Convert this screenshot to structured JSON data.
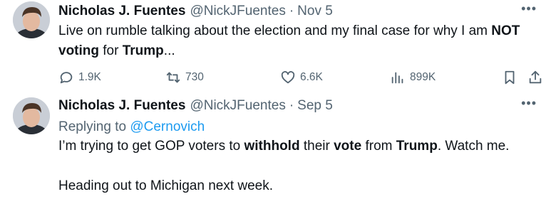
{
  "tweets": [
    {
      "author_name": "Nicholas J. Fuentes",
      "handle": "@NickJFuentes",
      "separator": "·",
      "date": "Nov 5",
      "more_icon": "more-horizontal-icon",
      "text_parts": {
        "t1": "Live on rumble talking about the election and my final case for why I am ",
        "b1": "NOT",
        "t2": " ",
        "b2": "voting",
        "t3": " for ",
        "b3": "Trump",
        "t4": "..."
      },
      "actions": {
        "replies": "1.9K",
        "reposts": "730",
        "likes": "6.6K",
        "views": "899K"
      }
    },
    {
      "author_name": "Nicholas J. Fuentes",
      "handle": "@NickJFuentes",
      "separator": "·",
      "date": "Sep 5",
      "more_icon": "more-horizontal-icon",
      "replying_to_label": "Replying to ",
      "replying_to_handle": "@Cernovich",
      "line1": {
        "t1": "I’m trying to get GOP voters to ",
        "b1": "withhold",
        "t2": " their ",
        "b2": "vote",
        "t3": " from ",
        "b3": "Trump",
        "t4": ". Watch me."
      },
      "line2": "Heading out to Michigan next week."
    }
  ],
  "colors": {
    "text": "#0f1419",
    "secondary": "#536471",
    "link": "#1d9bf0"
  }
}
